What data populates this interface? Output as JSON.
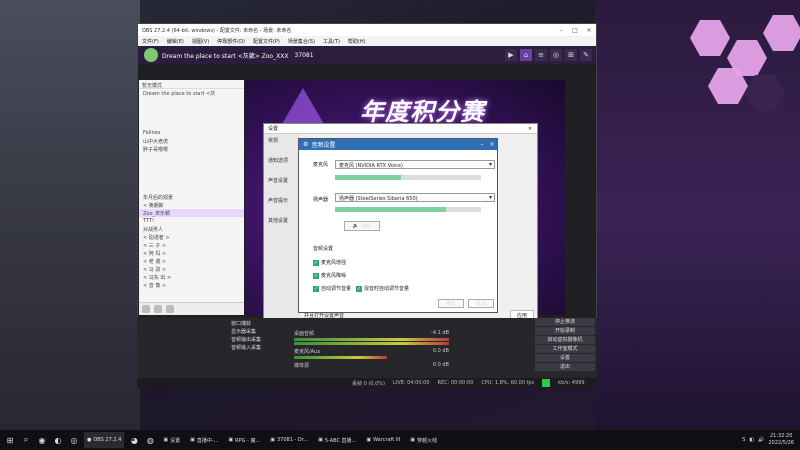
{
  "obs": {
    "title": "OBS 27.2.4 (64-bit, windows) - 配置文件: 未命名 - 场景: 未命名",
    "menu": [
      "文件(F)",
      "编辑(E)",
      "视图(V)",
      "停靠部件(D)",
      "配置文件(P)",
      "场景集合(S)",
      "工具(T)",
      "帮助(H)"
    ],
    "stream_title": "Dream the place to start <灰葳> Zoo_XXX",
    "stream_viewers": "37081",
    "banner_text": "年度积分赛"
  },
  "chat": {
    "header": "暂无模式",
    "lines": [
      "Dream the place to start <灰",
      "",
      "",
      "",
      "",
      "Felines",
      "山中大老虎",
      "胖子哥嘤嘤",
      "",
      "",
      "",
      "",
      "",
      "年月后的观景",
      "< 奥朗斯",
      "Zoo_宋乐颖",
      "TTT!",
      "对战男人",
      "< 珀诺者 >",
      "< 三 子 >",
      "< 阿 玛 >",
      "< 老 谢 >",
      "< 马 驭 >",
      "< 马东 出 >",
      "< 音 像 >"
    ]
  },
  "settings": {
    "title": "设置",
    "sections": [
      "常规",
      "通知选项",
      "声音设置",
      "声音提示",
      "其他设置"
    ],
    "apply": "应用",
    "footer": "并且打开设置声音"
  },
  "audio_dialog": {
    "title": "音频设置",
    "mic_label": "麦克风",
    "mic_device": "麦克风 (NVIDIA RTX Voice)",
    "mic_level": 0.45,
    "speaker_label": "扬声器",
    "speaker_device": "扬声器 (SteelSeries Siberia 650)",
    "speaker_level": 0.76,
    "test_button": "试听",
    "section_label": "音频设置",
    "options": [
      "麦克风增强",
      "麦克风降噪",
      "自动调节音量",
      "混音时自动调节音量"
    ],
    "ok": "确定",
    "cancel": "取消"
  },
  "docks": {
    "scenes": [
      "窗口捕获",
      "显示器采集",
      "音频输出采集",
      "音频输入采集"
    ],
    "mixer": [
      {
        "name": "桌面音频",
        "db": "-4.1 dB"
      },
      {
        "name": "麦克风/Aux",
        "db": "0.0 dB"
      },
      {
        "name": "媒体源",
        "db": "0.0 dB"
      }
    ],
    "controls": [
      "停止推流",
      "开始录制",
      "启动虚拟摄像机",
      "工作室模式",
      "设置",
      "退出"
    ]
  },
  "status": {
    "dropped": "丢帧 0 (0.0%)",
    "live": "LIVE: 04:00:00",
    "rec": "REC: 00:00:00",
    "cpu": "CPU: 1.8%, 60.00 fps",
    "kbps": "kb/s: 4999"
  },
  "taskbar": {
    "items": [
      "OBS 27.2.4",
      "设置",
      "直播中-...",
      "RPG - 魔...",
      "37081 - Dr...",
      "5-ABC 直播...",
      "Warcraft III",
      "穿越火线"
    ],
    "time": "21:32:20",
    "date": "2022/5/26"
  },
  "colors": {
    "accent": "#2e6fb6",
    "level": "#7fd0a0",
    "rec": "#2ecc40",
    "preview": "#7a2da8"
  }
}
